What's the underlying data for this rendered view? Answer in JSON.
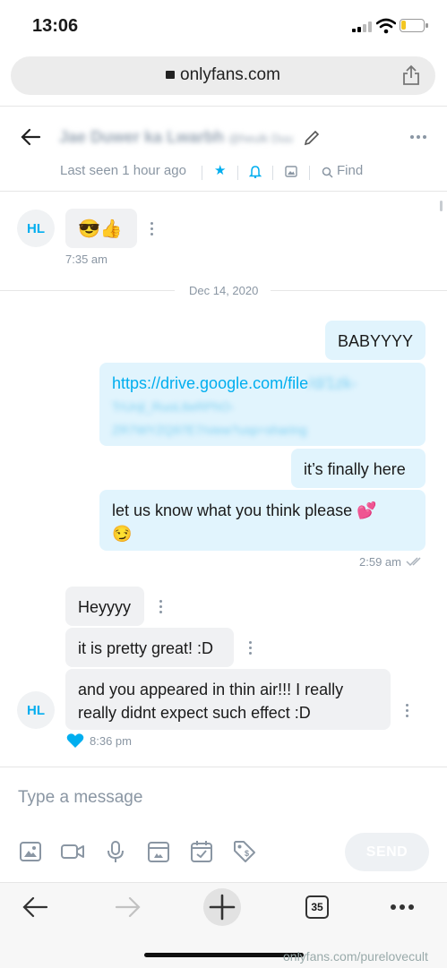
{
  "status_bar": {
    "time": "13:06"
  },
  "browser": {
    "url": "onlyfans.com",
    "tab_count": "35"
  },
  "chat_header": {
    "contact_name": "Jae Duwer ka Lwarbh",
    "contact_handle": "@heulk Duu",
    "last_seen": "Last seen 1 hour ago",
    "find_label": "Find"
  },
  "messages": {
    "first_avatar": "HL",
    "first_emoji": "😎👍",
    "first_time": "7:35 am",
    "date_divider": "Dec 14, 2020",
    "outgoing": {
      "m1": "BABYYYY",
      "link_visible": "https://drive.google.com/file",
      "link_blurred_1": "/d/1zk-",
      "link_blurred_2": "TrUnjl_RuoL6eRPhO-",
      "link_blurred_3": "ZR7WYZQ97E7/view?usp=sharing",
      "m3": "it’s finally here",
      "m4": "let us know what you think please 💕",
      "m4_emoji": "😏",
      "time": "2:59 am"
    },
    "incoming": {
      "m1": "Heyyyy",
      "m2": "it is pretty great! :D",
      "m3": "and you appeared in thin air!!! I really really didnt expect such effect :D",
      "avatar": "HL",
      "time": "8:36 pm"
    }
  },
  "composer": {
    "placeholder": "Type a message",
    "send_label": "SEND"
  },
  "watermark": "onlyfans.com/purelovecult"
}
